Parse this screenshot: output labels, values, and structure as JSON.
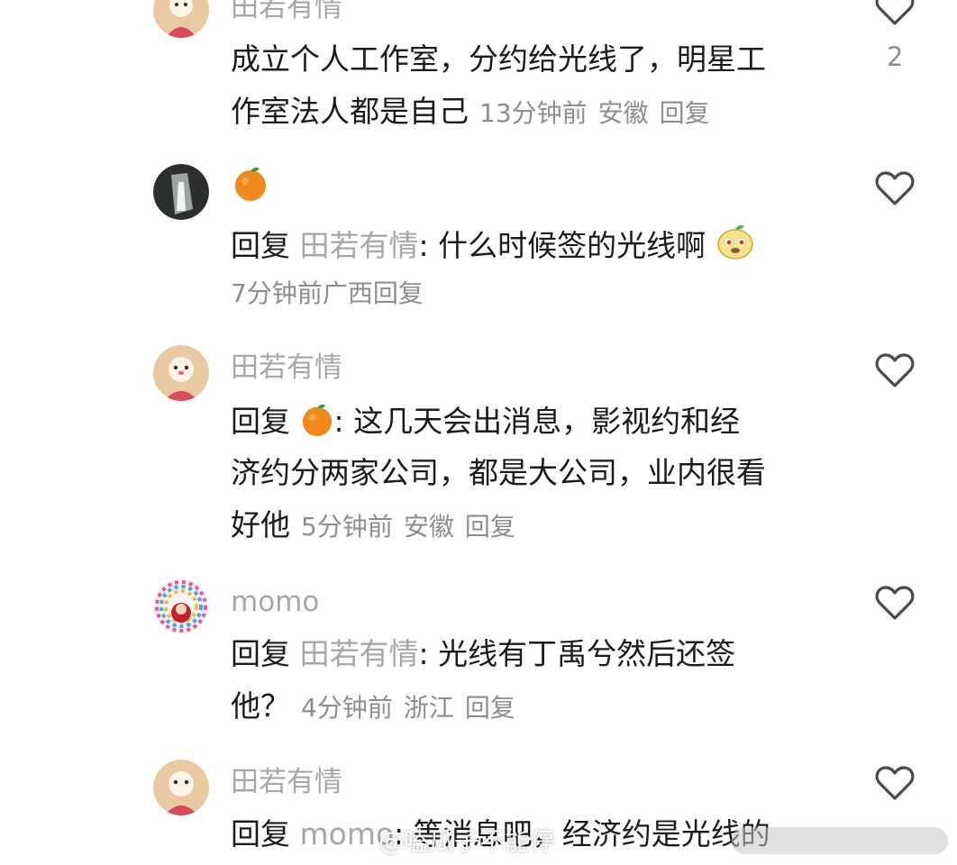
{
  "comments": [
    {
      "username": "田若有情",
      "lines": [
        "成立个人工作室，分约给光线了，明星工",
        "作室法人都是自己"
      ],
      "time": "13分钟前",
      "location": "安徽",
      "reply_label": "回复",
      "likes": "2"
    },
    {
      "username_icon": "orange-emoji",
      "reply_prefix": "回复",
      "reply_to": "田若有情",
      "text": ": 什么时候签的光线啊",
      "time": "7分钟前",
      "location": "广西",
      "reply_label": "回复"
    },
    {
      "username": "田若有情",
      "reply_prefix": "回复",
      "reply_to_icon": "orange-emoji",
      "lines": [
        ": 这几天会出消息，影视约和经",
        "济约分两家公司，都是大公司，业内很看",
        "好他"
      ],
      "time": "5分钟前",
      "location": "安徽",
      "reply_label": "回复"
    },
    {
      "username": "momo",
      "reply_prefix": "回复",
      "reply_to": "田若有情",
      "lines": [
        ": 光线有丁禹兮然后还签",
        "他？"
      ],
      "time": "4分钟前",
      "location": "浙江",
      "reply_label": "回复"
    },
    {
      "username": "田若有情",
      "reply_prefix": "回复",
      "reply_to": "momo",
      "text": ": 等消息吧，经济约是光线的"
    }
  ],
  "watermark": "@嗑瓜子不能停",
  "colors": {
    "username": "#a7a7a7",
    "meta": "#8d8d8d",
    "text": "#1b1b1b",
    "heart": "#4a4a4a"
  }
}
